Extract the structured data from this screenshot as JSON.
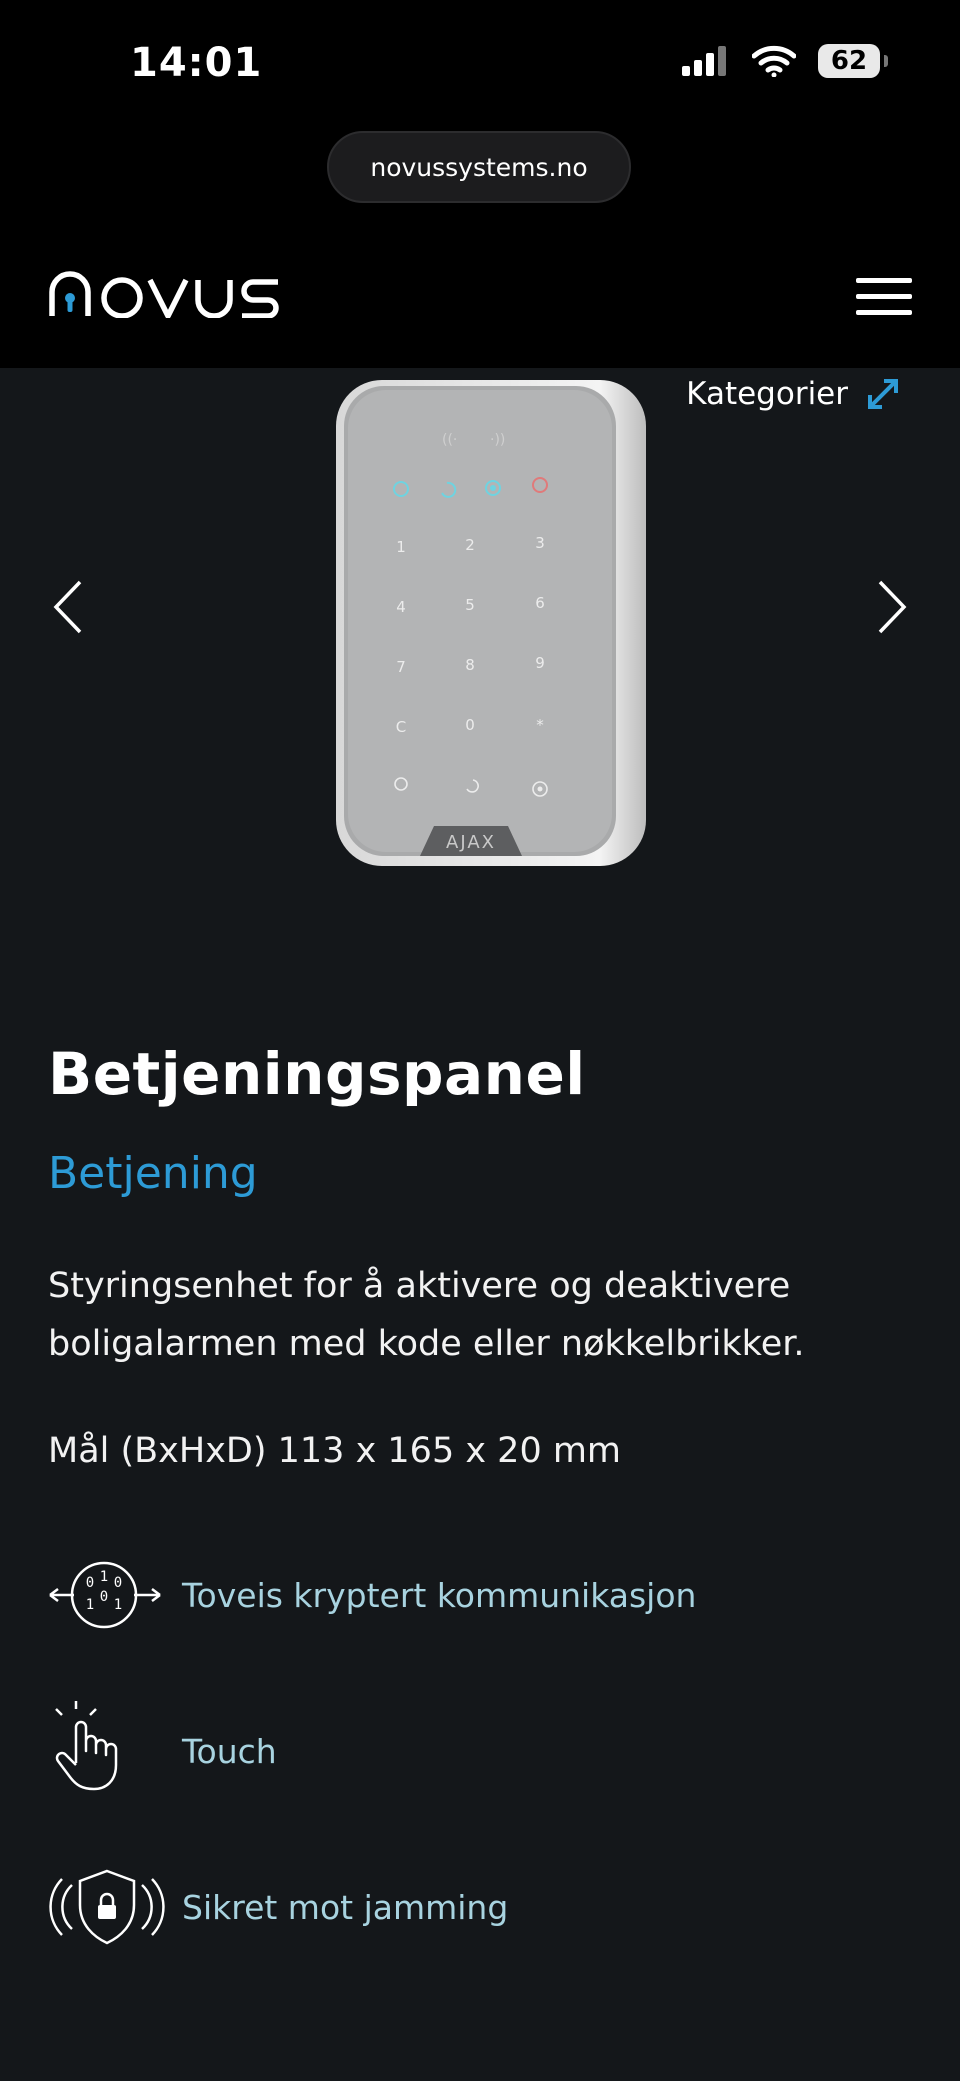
{
  "status_bar": {
    "time": "14:01",
    "battery": "62"
  },
  "browser": {
    "url": "novussystems.no"
  },
  "header": {
    "logo_text": "novus",
    "menu_icon": "hamburger-icon"
  },
  "hero": {
    "categories_label": "Kategorier",
    "categories_icon": "expand-arrows-icon",
    "prev_icon": "chevron-left-icon",
    "next_icon": "chevron-right-icon",
    "device_brand": "AJAX",
    "keypad_keys": [
      "1",
      "2",
      "3",
      "4",
      "5",
      "6",
      "7",
      "8",
      "9",
      "C",
      "0",
      "*"
    ]
  },
  "product": {
    "title": "Betjeningspanel",
    "category": "Betjening",
    "description": "Styringsenhet for å aktivere og deaktivere boligalarmen med kode eller nøkkelbrikker.",
    "dimensions": "Mål (BxHxD) 113 x 165 x 20 mm"
  },
  "features": [
    {
      "label": "Toveis kryptert kommunikasjon",
      "icon": "encrypted-communication-icon"
    },
    {
      "label": "Touch",
      "icon": "touch-hand-icon"
    },
    {
      "label": "Sikret mot jamming",
      "icon": "shield-lock-icon"
    }
  ],
  "colors": {
    "accent": "#2d9bd6",
    "feature_text": "#a8d3e0",
    "background": "#14171a"
  }
}
